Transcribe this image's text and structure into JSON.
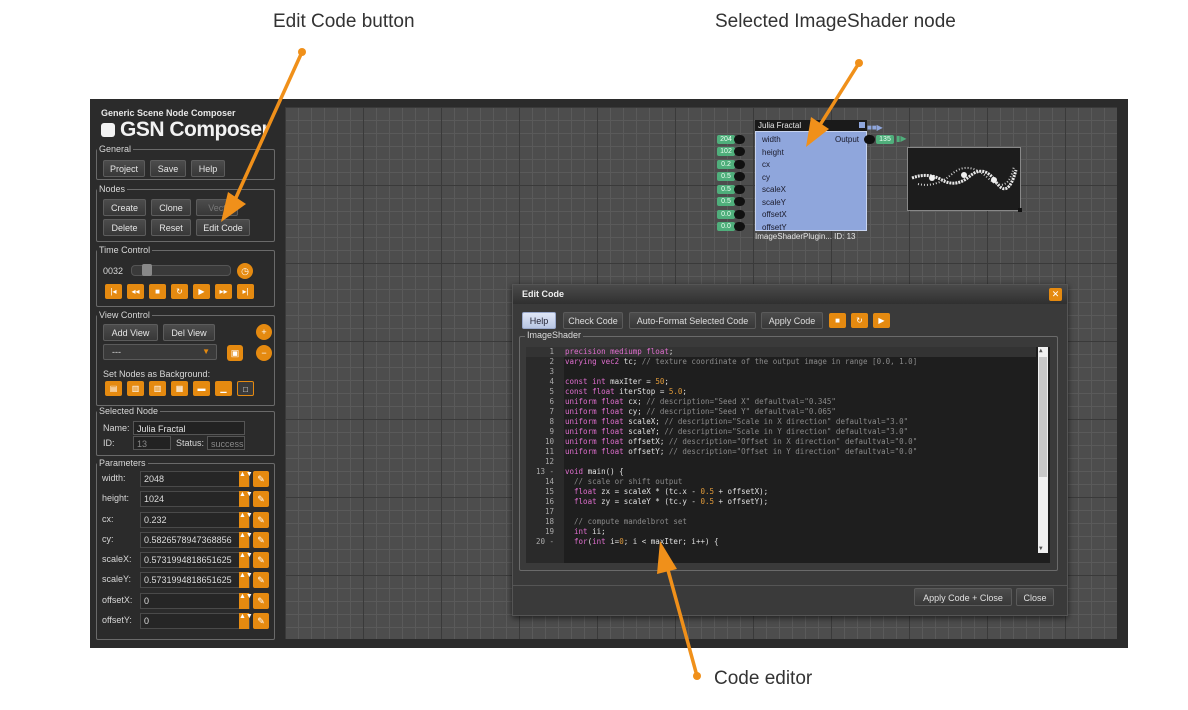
{
  "callouts": {
    "edit_code": "Edit Code button",
    "selected_node": "Selected ImageShader node",
    "code_editor": "Code editor"
  },
  "colors": {
    "accent": "#e58a10",
    "node": "#8fa6dc",
    "canvas": "#4d4d4d",
    "port_value": "#4fae7b"
  },
  "app": {
    "subtitle": "Generic Scene Node Composer",
    "title": "GSN Composer"
  },
  "general": {
    "legend": "General",
    "project": "Project",
    "save": "Save",
    "help": "Help"
  },
  "nodes": {
    "legend": "Nodes",
    "create": "Create",
    "clone": "Clone",
    "vectorize": "Vect",
    "delete": "Delete",
    "reset": "Reset",
    "edit_code": "Edit Code"
  },
  "time": {
    "legend": "Time Control",
    "frame": "0032"
  },
  "view": {
    "legend": "View Control",
    "add_view": "Add View",
    "del_view": "Del View",
    "select_value": "---",
    "bg_label": "Set Nodes as Background:"
  },
  "selected": {
    "legend": "Selected Node",
    "name_label": "Name:",
    "name_value": "Julia Fractal",
    "id_label": "ID:",
    "id_value": "13",
    "status_label": "Status:",
    "status_value": "success"
  },
  "params": {
    "legend": "Parameters",
    "rows": [
      {
        "label": "width:",
        "value": "2048"
      },
      {
        "label": "height:",
        "value": "1024"
      },
      {
        "label": "cx:",
        "value": "0.232"
      },
      {
        "label": "cy:",
        "value": "0.5826578947368856"
      },
      {
        "label": "scaleX:",
        "value": "0.5731994818651625"
      },
      {
        "label": "scaleY:",
        "value": "0.5731994818651625"
      },
      {
        "label": "offsetX:",
        "value": "0"
      },
      {
        "label": "offsetY:",
        "value": "0"
      }
    ]
  },
  "node": {
    "title": "Julia Fractal",
    "output_label": "Output",
    "output_value": "135",
    "footer": "ImageShaderPlugin... ID: 13",
    "inputs": [
      {
        "label": "width",
        "value": "204"
      },
      {
        "label": "height",
        "value": "102"
      },
      {
        "label": "cx",
        "value": "0.2"
      },
      {
        "label": "cy",
        "value": "0.5"
      },
      {
        "label": "scaleX",
        "value": "0.5"
      },
      {
        "label": "scaleY",
        "value": "0.5"
      },
      {
        "label": "offsetX",
        "value": "0.0"
      },
      {
        "label": "offsetY",
        "value": "0.0"
      }
    ]
  },
  "dialog": {
    "title": "Edit Code",
    "help": "Help",
    "check": "Check Code",
    "autoformat": "Auto-Format Selected Code",
    "apply": "Apply Code",
    "section": "ImageShader",
    "apply_close": "Apply Code + Close",
    "close": "Close"
  },
  "code_lines": [
    {
      "n": "1",
      "t": "precision mediump float;"
    },
    {
      "n": "2",
      "t": "varying vec2 tc; // texture coordinate of the output image in range [0.0, 1.0]"
    },
    {
      "n": "3",
      "t": ""
    },
    {
      "n": "4",
      "t": "const int maxIter = 50;"
    },
    {
      "n": "5",
      "t": "const float iterStop = 5.0;"
    },
    {
      "n": "6",
      "t": "uniform float cx; // description=\"Seed X\" defaultval=\"0.345\""
    },
    {
      "n": "7",
      "t": "uniform float cy; // description=\"Seed Y\" defaultval=\"0.065\""
    },
    {
      "n": "8",
      "t": "uniform float scaleX; // description=\"Scale in X direction\" defaultval=\"3.0\""
    },
    {
      "n": "9",
      "t": "uniform float scaleY; // description=\"Scale in Y direction\" defaultval=\"3.0\""
    },
    {
      "n": "10",
      "t": "uniform float offsetX; // description=\"Offset in X direction\" defaultval=\"0.0\""
    },
    {
      "n": "11",
      "t": "uniform float offsetY; // description=\"Offset in Y direction\" defaultval=\"0.0\""
    },
    {
      "n": "12",
      "t": ""
    },
    {
      "n": "13 -",
      "t": "void main() {"
    },
    {
      "n": "14",
      "t": "  // scale or shift output"
    },
    {
      "n": "15",
      "t": "  float zx = scaleX * (tc.x - 0.5 + offsetX);"
    },
    {
      "n": "16",
      "t": "  float zy = scaleY * (tc.y - 0.5 + offsetY);"
    },
    {
      "n": "17",
      "t": ""
    },
    {
      "n": "18",
      "t": "  // compute mandelbrot set"
    },
    {
      "n": "19",
      "t": "  int ii;"
    },
    {
      "n": "20 -",
      "t": "  for(int i=0; i < maxIter; i++) {"
    }
  ]
}
